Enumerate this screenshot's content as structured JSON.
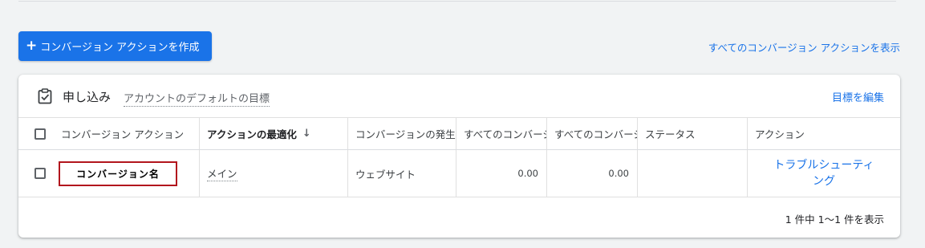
{
  "toolbar": {
    "create_label": "コンバージョン アクションを作成",
    "create_icon": "plus-icon",
    "view_all_link": "すべてのコンバージョン アクションを表示"
  },
  "goal": {
    "icon": "clipboard-check-icon",
    "name": "申し込み",
    "description": "アカウントのデフォルトの目標",
    "edit_link": "目標を編集"
  },
  "table": {
    "headers": {
      "conversion_action": "コンバージョン アクション",
      "action_optimization": "アクションの最適化",
      "sort_indicator": "↓",
      "source": "コンバージョンの発生元",
      "all_conv_1": "すべてのコンバージョン",
      "all_conv_2": "すべてのコンバージョン",
      "status": "ステータス",
      "actions": "アクション"
    },
    "rows": [
      {
        "name": "コンバージョン名",
        "optimization": "メイン",
        "source": "ウェブサイト",
        "all_conv_1": "0.00",
        "all_conv_2": "0.00",
        "status": "",
        "action_link": "トラブルシューティング"
      }
    ],
    "footer": "1 件中 1～1 件を表示"
  },
  "colors": {
    "accent": "#1a73e8",
    "highlight_border": "#b2161d",
    "background": "#f1f3f4"
  }
}
